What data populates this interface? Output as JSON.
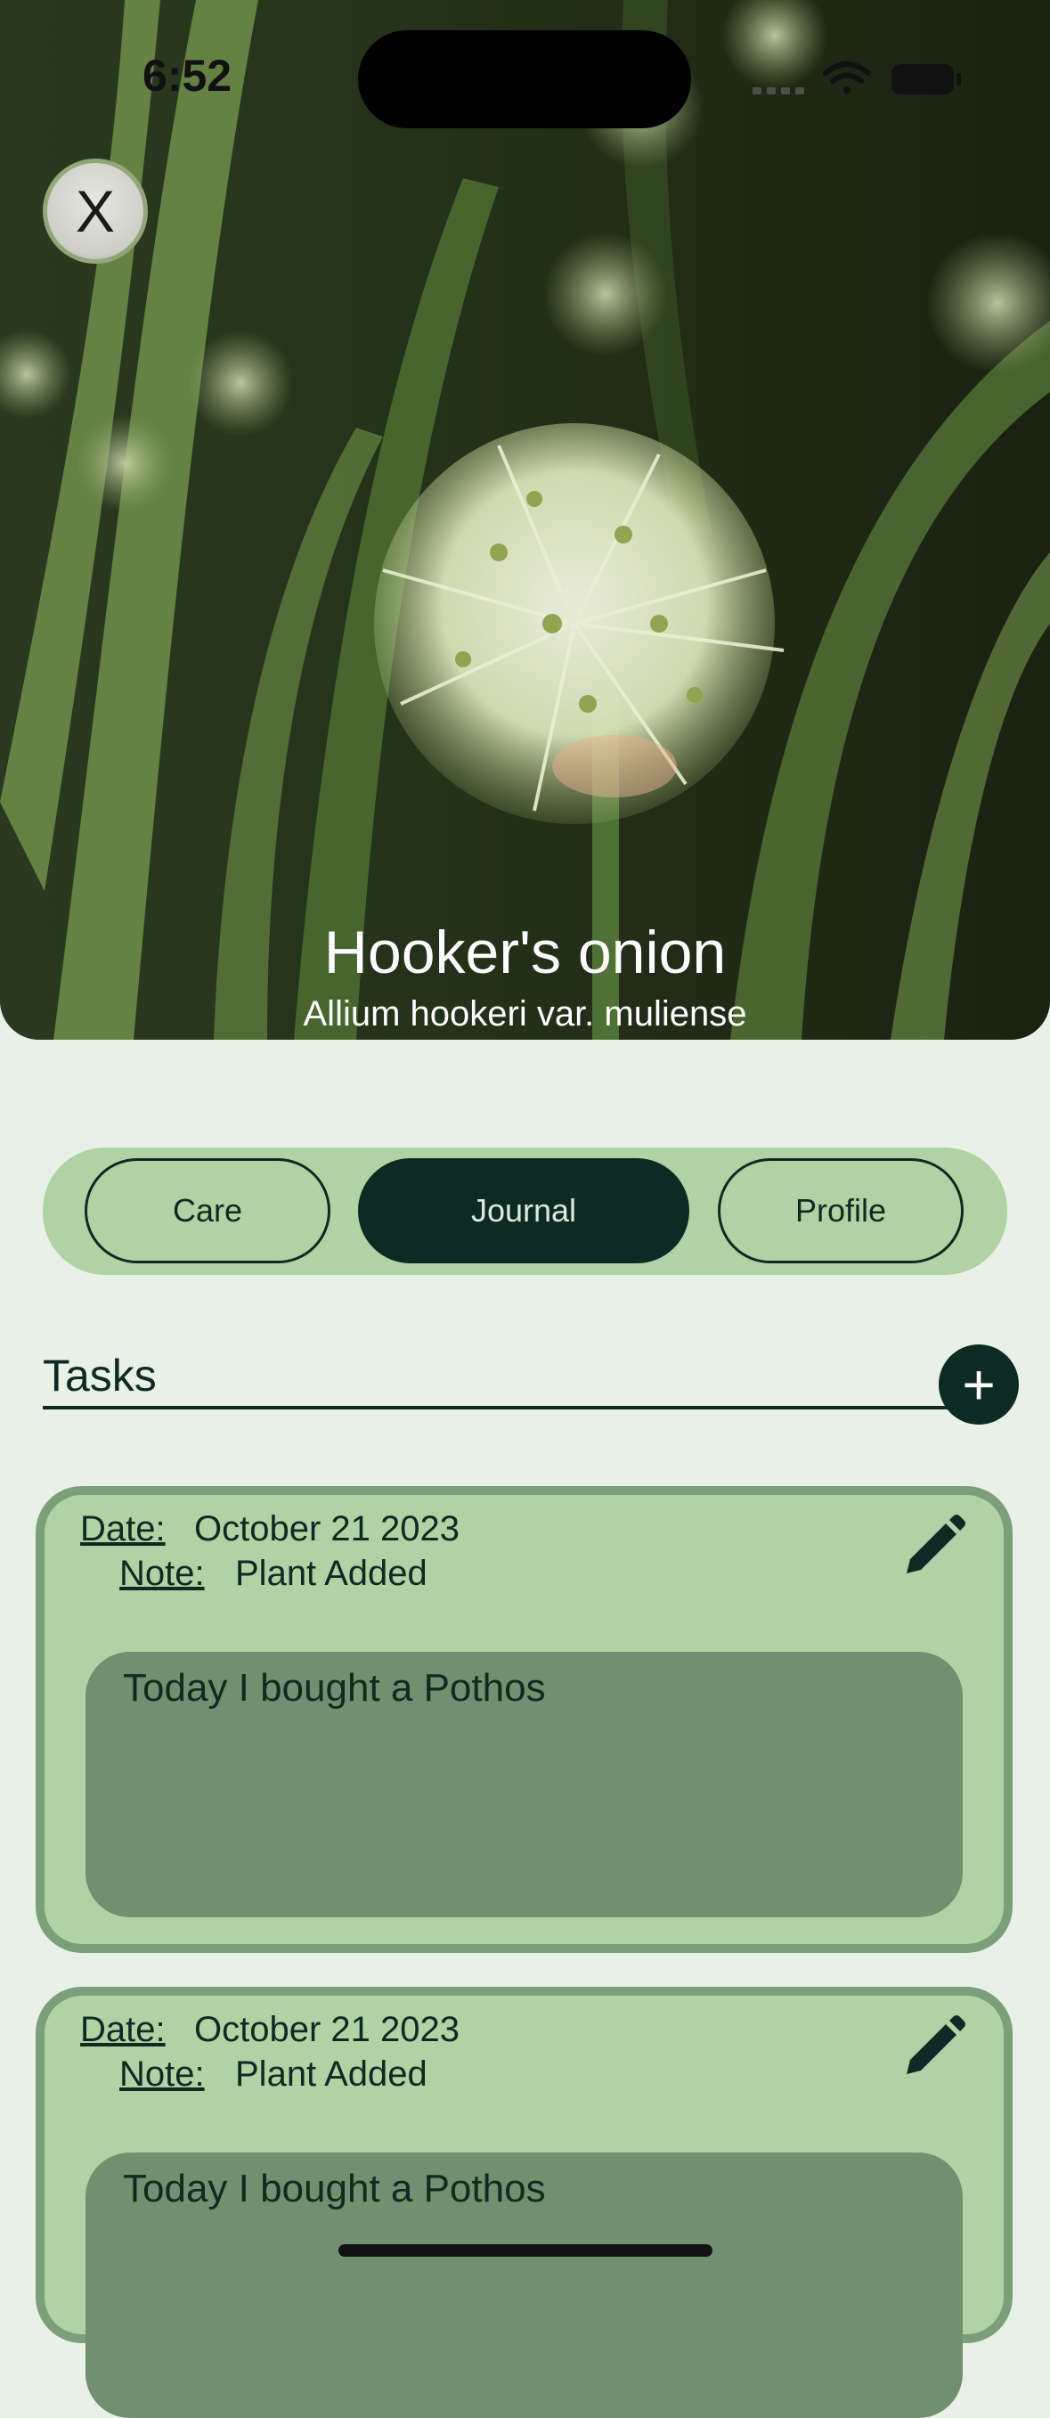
{
  "status_bar": {
    "time": "6:52"
  },
  "header": {
    "close_label": "X",
    "plant_name": "Hooker's onion",
    "scientific_name": "Allium hookeri var. muliense"
  },
  "tabs": [
    {
      "label": "Care",
      "selected": false
    },
    {
      "label": "Journal",
      "selected": true
    },
    {
      "label": "Profile",
      "selected": false
    }
  ],
  "tasks": {
    "title": "Tasks",
    "add_label": "+"
  },
  "entries": [
    {
      "date_label": "Date:",
      "date": "October 21 2023",
      "note_label": "Note:",
      "note": "Plant Added",
      "text": "Today I bought a Pothos"
    },
    {
      "date_label": "Date:",
      "date": "October 21 2023",
      "note_label": "Note:",
      "note": "Plant Added",
      "text": "Today I bought a Pothos"
    }
  ],
  "colors": {
    "background": "#e8f1e6",
    "accent_dark": "#0e2b23",
    "card": "#b0d2a4",
    "card_border": "#7d9e7b",
    "card_body": "#728f6f"
  },
  "icons": [
    "close-icon",
    "plus-icon",
    "pencil-icon",
    "wifi-icon",
    "battery-icon"
  ]
}
